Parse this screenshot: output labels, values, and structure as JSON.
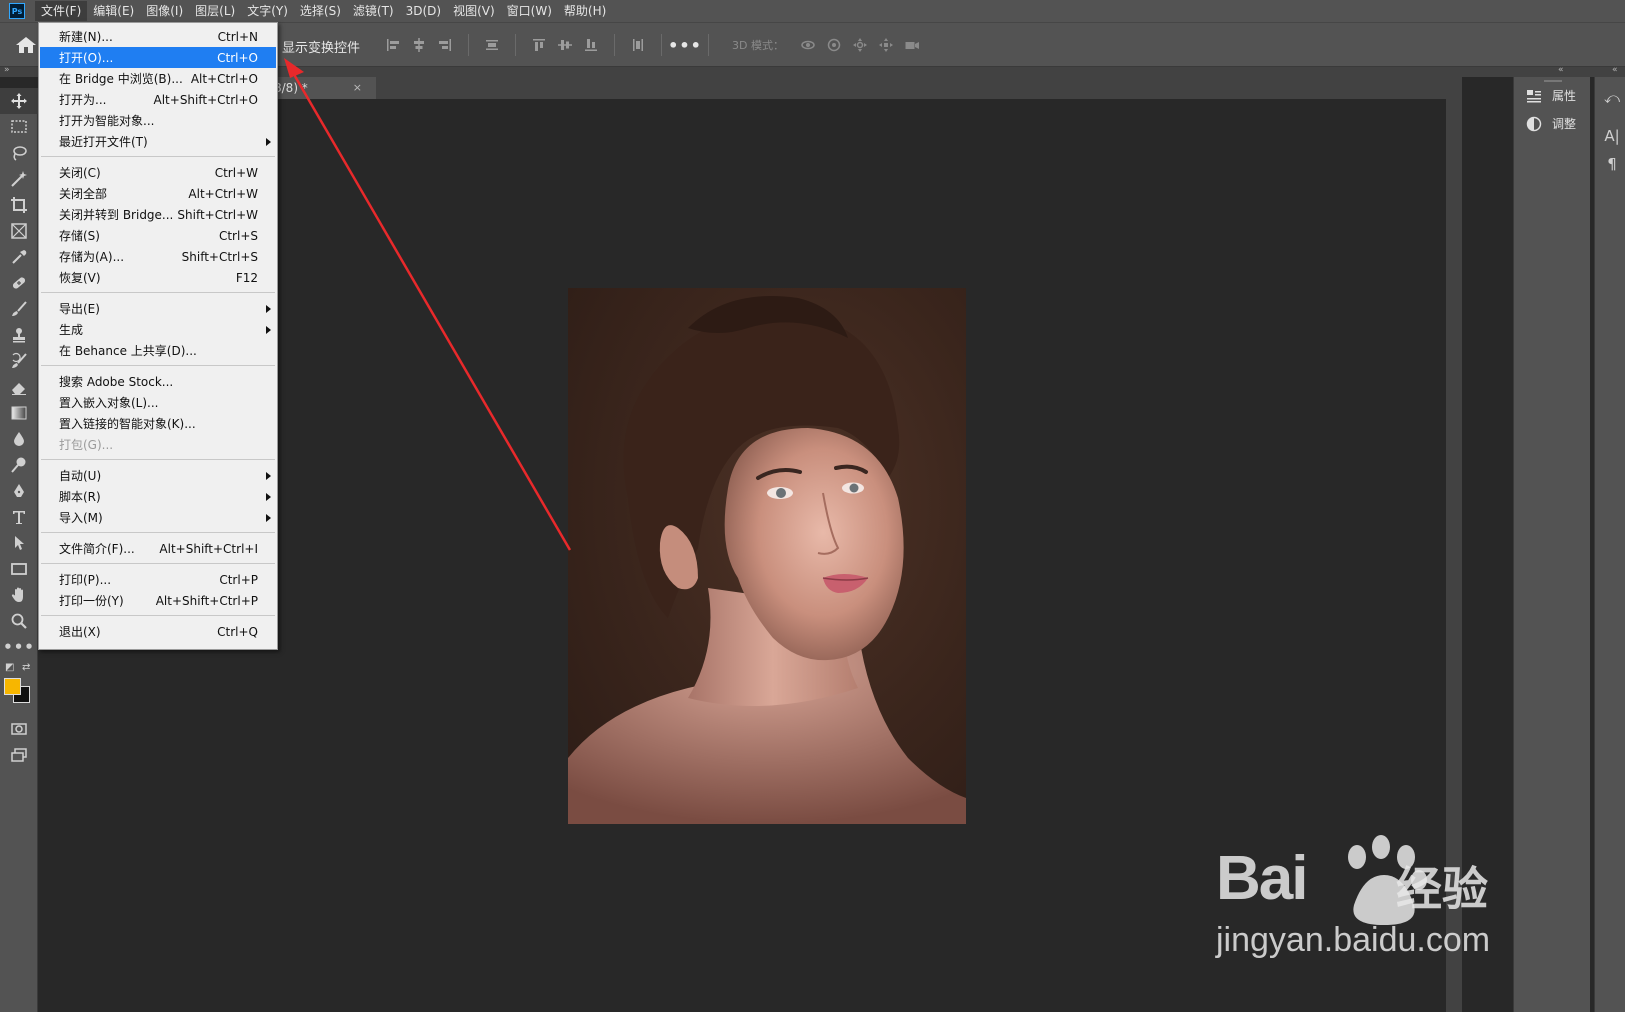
{
  "menubar": {
    "logo": "Ps",
    "items": [
      "文件(F)",
      "编辑(E)",
      "图像(I)",
      "图层(L)",
      "文字(Y)",
      "选择(S)",
      "滤镜(T)",
      "3D(D)",
      "视图(V)",
      "窗口(W)",
      "帮助(H)"
    ]
  },
  "optionsbar": {
    "show_transform": "显示变换控件",
    "mode_3d": "3D 模式："
  },
  "document": {
    "tab_label": "8/8) *",
    "close": "×"
  },
  "file_menu": {
    "groups": [
      [
        {
          "label": "新建(N)...",
          "shortcut": "Ctrl+N"
        },
        {
          "label": "打开(O)...",
          "shortcut": "Ctrl+O",
          "highlight": true
        },
        {
          "label": "在 Bridge 中浏览(B)...",
          "shortcut": "Alt+Ctrl+O"
        },
        {
          "label": "打开为...",
          "shortcut": "Alt+Shift+Ctrl+O"
        },
        {
          "label": "打开为智能对象...",
          "shortcut": ""
        },
        {
          "label": "最近打开文件(T)",
          "shortcut": "",
          "submenu": true
        }
      ],
      [
        {
          "label": "关闭(C)",
          "shortcut": "Ctrl+W"
        },
        {
          "label": "关闭全部",
          "shortcut": "Alt+Ctrl+W"
        },
        {
          "label": "关闭并转到 Bridge...",
          "shortcut": "Shift+Ctrl+W"
        },
        {
          "label": "存储(S)",
          "shortcut": "Ctrl+S"
        },
        {
          "label": "存储为(A)...",
          "shortcut": "Shift+Ctrl+S"
        },
        {
          "label": "恢复(V)",
          "shortcut": "F12"
        }
      ],
      [
        {
          "label": "导出(E)",
          "shortcut": "",
          "submenu": true
        },
        {
          "label": "生成",
          "shortcut": "",
          "submenu": true
        },
        {
          "label": "在 Behance 上共享(D)...",
          "shortcut": ""
        }
      ],
      [
        {
          "label": "搜索 Adobe Stock...",
          "shortcut": ""
        },
        {
          "label": "置入嵌入对象(L)...",
          "shortcut": ""
        },
        {
          "label": "置入链接的智能对象(K)...",
          "shortcut": ""
        },
        {
          "label": "打包(G)...",
          "shortcut": "",
          "disabled": true
        }
      ],
      [
        {
          "label": "自动(U)",
          "shortcut": "",
          "submenu": true
        },
        {
          "label": "脚本(R)",
          "shortcut": "",
          "submenu": true
        },
        {
          "label": "导入(M)",
          "shortcut": "",
          "submenu": true
        }
      ],
      [
        {
          "label": "文件简介(F)...",
          "shortcut": "Alt+Shift+Ctrl+I"
        }
      ],
      [
        {
          "label": "打印(P)...",
          "shortcut": "Ctrl+P"
        },
        {
          "label": "打印一份(Y)",
          "shortcut": "Alt+Shift+Ctrl+P"
        }
      ],
      [
        {
          "label": "退出(X)",
          "shortcut": "Ctrl+Q"
        }
      ]
    ]
  },
  "right_panel": {
    "properties": "属性",
    "adjustments": "调整"
  },
  "tools": [
    "move-icon",
    "marquee-icon",
    "lasso-icon",
    "magic-wand-icon",
    "crop-icon",
    "frame-icon",
    "eyedropper-icon",
    "healing-brush-icon",
    "brush-icon",
    "clone-stamp-icon",
    "history-brush-icon",
    "eraser-icon",
    "gradient-icon",
    "blur-icon",
    "dodge-icon",
    "pen-icon",
    "type-icon",
    "path-select-icon",
    "rectangle-icon",
    "hand-icon",
    "zoom-icon",
    "more-tools-icon"
  ],
  "colors": {
    "foreground": "#f7b600",
    "background": "#111111",
    "menu_highlight": "#1f7ef2",
    "annotation_arrow": "#e8292b"
  },
  "watermark": {
    "brand": "Bai",
    "brand2": "经验",
    "url": "jingyan.baidu.com"
  }
}
